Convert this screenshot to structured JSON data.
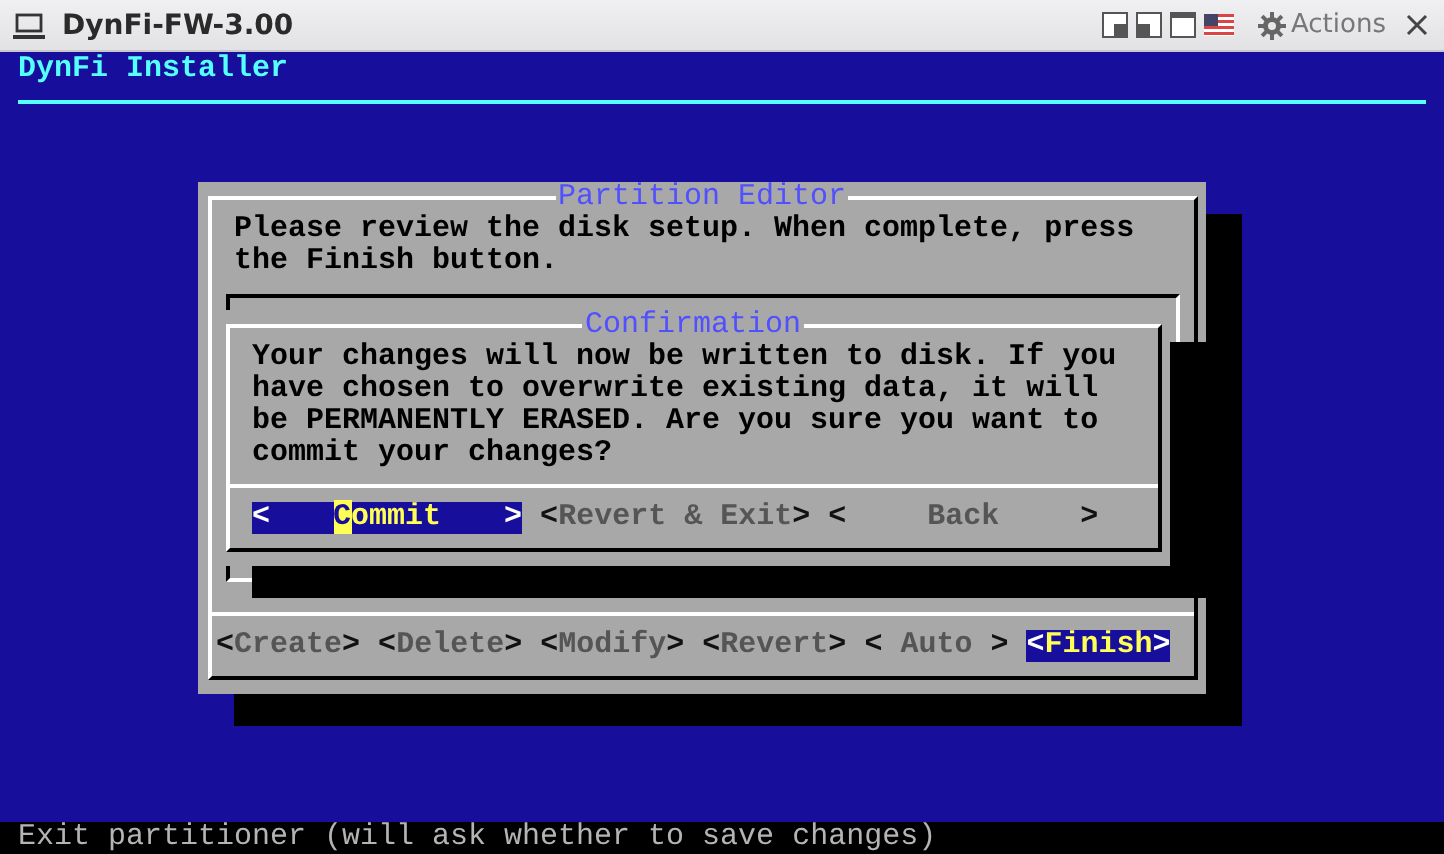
{
  "window": {
    "title": "DynFi-FW-3.00",
    "actions_label": "Actions"
  },
  "console": {
    "header": "DynFi Installer",
    "status_line": "Exit partitioner (will ask whether to save changes)"
  },
  "partition_editor": {
    "kind": "editor",
    "title": "Partition Editor",
    "message": "Please review the disk setup. When complete, press the Finish button.",
    "buttons": [
      {
        "open": "<",
        "label": "Create",
        "close": ">",
        "selected": false,
        "cursor": false
      },
      {
        "open": "<",
        "label": "Delete",
        "close": ">",
        "selected": false,
        "cursor": false
      },
      {
        "open": "<",
        "label": "Modify",
        "close": ">",
        "selected": false,
        "cursor": false
      },
      {
        "open": "<",
        "label": "Revert",
        "close": ">",
        "selected": false,
        "cursor": false
      },
      {
        "open": "<",
        "label": "Auto",
        "close": ">",
        "selected": false,
        "cursor": false
      },
      {
        "open": "<",
        "label": "Finish",
        "close": ">",
        "selected": true,
        "cursor": false
      }
    ]
  },
  "confirmation": {
    "kind": "confirm",
    "title": "Confirmation",
    "message": "Your changes will now be written to disk. If you have chosen to overwrite existing data, it will be PERMANENTLY ERASED. Are you sure you want to commit your changes?",
    "buttons": [
      {
        "open": "<",
        "label": "Commit",
        "close": ">",
        "selected": true,
        "cursor": true
      },
      {
        "open": "<",
        "label": "Revert & Exit",
        "close": ">",
        "selected": false,
        "cursor": false
      },
      {
        "open": "<",
        "label": "Back",
        "close": ">",
        "selected": false,
        "cursor": false
      }
    ]
  }
}
